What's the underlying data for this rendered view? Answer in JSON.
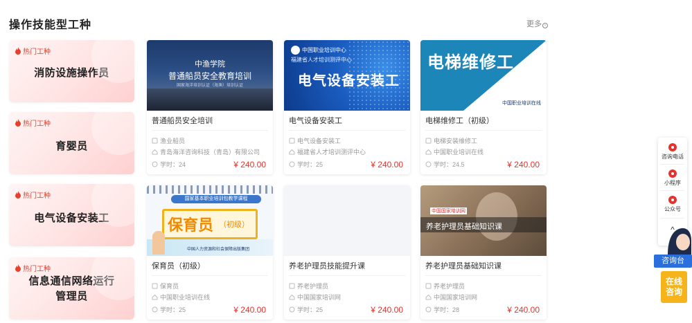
{
  "section": {
    "title": "操作技能型工种",
    "more_label": "更多",
    "more_icon": "chevron-right-icon"
  },
  "categories": [
    {
      "tag": "热门工种",
      "name": "消防设施操作员"
    },
    {
      "tag": "热门工种",
      "name": "育婴员"
    },
    {
      "tag": "热门工种",
      "name": "电气设备安装工"
    },
    {
      "tag": "热门工种",
      "name": "信息通信网络运行管理员"
    }
  ],
  "courses": [
    {
      "title": "普通船员安全培训",
      "type": "渔业船员",
      "org": "青岛海洋咨询科技（青岛）有限公司",
      "hours": "学时：24",
      "price": "¥ 240.00",
      "thumb": {
        "line1": "中渔学院",
        "line2": "普通船员安全教育培训",
        "line3": "国家海洋培训认证（海渔）培训认证"
      }
    },
    {
      "title": "电气设备安装工",
      "type": "电气设备安装工",
      "org": "福建省人才培训测评中心",
      "hours": "学时：25",
      "price": "¥ 240.00",
      "thumb": {
        "line1": "中国职业培训中心",
        "line2": "福建省人才培训测评中心",
        "line3": "电气设备安装工"
      }
    },
    {
      "title": "电梯维修工（初级）",
      "type": "电梯安装维修工",
      "org": "中国职业培训在线",
      "hours": "学时：24.5",
      "price": "¥ 240.00",
      "thumb": {
        "line1": "电梯维修工",
        "line2": "中国职业培训在线"
      }
    },
    {
      "title": "保育员（初级）",
      "type": "保育员",
      "org": "中国职业培训在线",
      "hours": "学时：25",
      "price": "¥ 240.00",
      "thumb": {
        "line1": "国家基本职业培训包教学课程",
        "line2": "保育员",
        "line3": "（初级）",
        "line4": "中国人力资源和社会保障出版集团"
      }
    },
    {
      "title": "养老护理员技能提升课",
      "type": "养老护理员",
      "org": "中国国家培训网",
      "hours": "学时：25",
      "price": "¥ 240.00",
      "thumb": {}
    },
    {
      "title": "养老护理员基础知识课",
      "type": "养老护理员",
      "org": "中国国家培训网",
      "hours": "学时：28",
      "price": "¥ 240.00",
      "thumb": {
        "line1": "中国国家培训网",
        "line2": "养老护理员基础知识课"
      }
    }
  ],
  "float_panel": {
    "items": [
      {
        "label": "咨询电话",
        "icon": "phone-icon"
      },
      {
        "label": "小程序",
        "icon": "mini-program-icon"
      },
      {
        "label": "公众号",
        "icon": "wechat-icon"
      }
    ],
    "up_label": "^"
  },
  "consult": {
    "desk_label": "咨询台",
    "online_line1": "在线",
    "online_line2": "咨询"
  },
  "colors": {
    "accent": "#e5322d",
    "desk": "#2a6fdc",
    "online": "#f6b41c"
  }
}
